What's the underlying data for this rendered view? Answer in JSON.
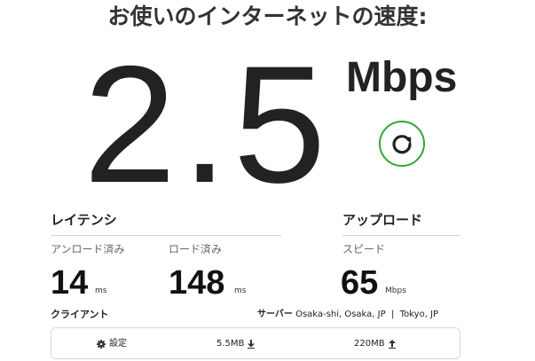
{
  "page": {
    "headline": "お使いのインターネットの速度:"
  },
  "speed": {
    "value": "2.5",
    "unit": "Mbps"
  },
  "icons": {
    "refresh": "refresh-icon",
    "settings": "gear-icon",
    "download": "download-icon",
    "upload": "upload-icon"
  },
  "colors": {
    "refresh_ring": "#2ea836",
    "divider": "#d4d4d4"
  },
  "latency": {
    "title": "レイテンシ",
    "unloaded": {
      "label": "アンロード済み",
      "value": "14",
      "unit": "ms"
    },
    "loaded": {
      "label": "ロード済み",
      "value": "148",
      "unit": "ms"
    }
  },
  "upload": {
    "title": "アップロード",
    "speed_label": "スピード",
    "value": "65",
    "unit": "Mbps"
  },
  "client": {
    "title": "クライアント"
  },
  "server": {
    "label": "サーバー",
    "locations": "Osaka-shi, Osaka, JP  |  Tokyo, JP"
  },
  "client_card": {
    "settings_label": "設定",
    "downloaded": "5.5MB",
    "uploaded": "220MB"
  }
}
